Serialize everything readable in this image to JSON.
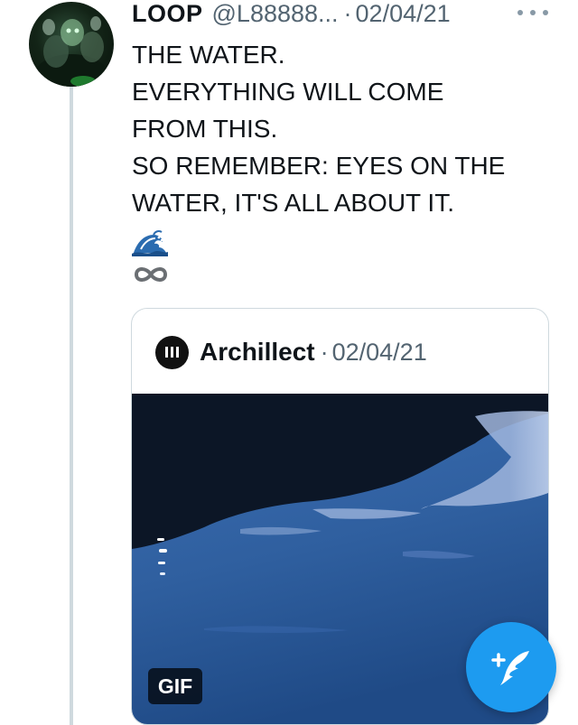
{
  "tweet": {
    "display_name": "LOOP",
    "handle": "@L88888...",
    "separator": "·",
    "date": "02/04/21",
    "more_icon": "more-horizontal-icon",
    "text_lines": [
      "THE WATER.",
      "EVERYTHING WILL COME",
      "FROM THIS.",
      "SO REMEMBER: EYES ON THE",
      "WATER, IT'S ALL ABOUT IT."
    ],
    "emojis": [
      "water-wave-emoji",
      "infinity-emoji"
    ]
  },
  "quote": {
    "display_name": "Archillect",
    "separator": "·",
    "date": "02/04/21",
    "media_badge": "GIF"
  },
  "compose_button": {
    "icon": "compose-tweet-icon",
    "color": "#1d9bf0"
  },
  "colors": {
    "text_primary": "#0f1419",
    "text_secondary": "#536471",
    "border": "#cfd9de",
    "accent": "#1d9bf0"
  }
}
